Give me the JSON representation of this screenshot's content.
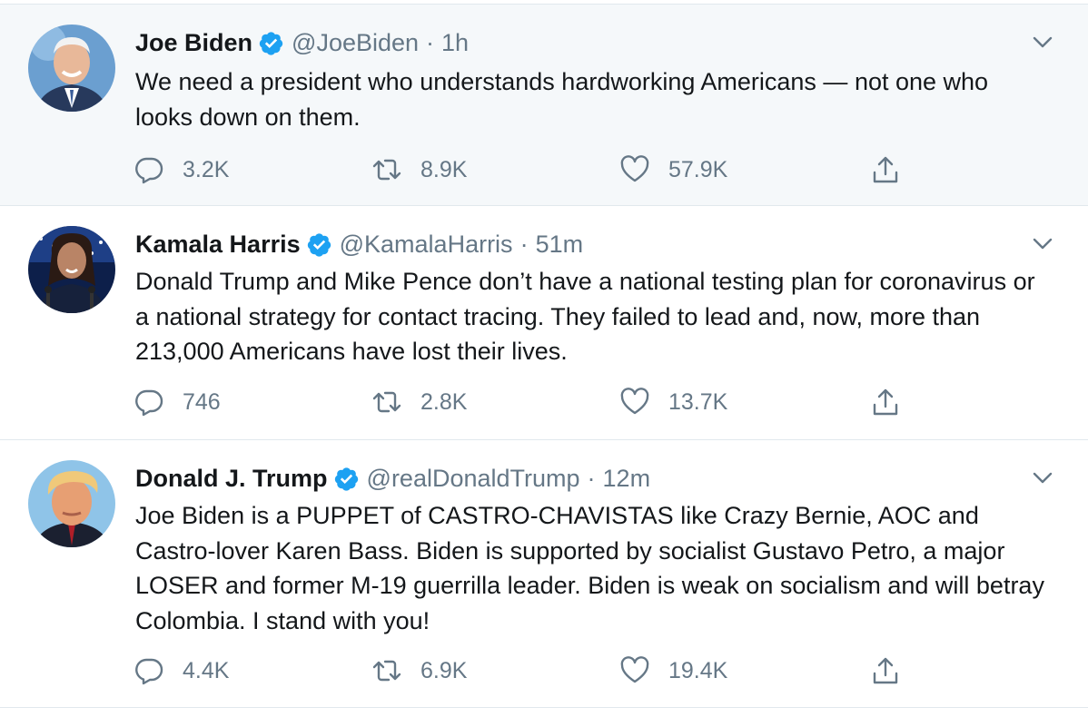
{
  "tweets": [
    {
      "name": "Joe Biden",
      "handle": "@JoeBiden",
      "separator": "·",
      "time": "1h",
      "text": "We need a president who understands hardworking Americans — not one who looks down on them.",
      "replies": "3.2K",
      "retweets": "8.9K",
      "likes": "57.9K"
    },
    {
      "name": "Kamala Harris",
      "handle": "@KamalaHarris",
      "separator": "·",
      "time": "51m",
      "text": "Donald Trump and Mike Pence don’t have a national testing plan for coronavirus or a national strategy for contact tracing. They failed to lead and, now, more than 213,000 Americans have lost their lives.",
      "replies": "746",
      "retweets": "2.8K",
      "likes": "13.7K"
    },
    {
      "name": "Donald J. Trump",
      "handle": "@realDonaldTrump",
      "separator": "·",
      "time": "12m",
      "text": "Joe Biden is a PUPPET of CASTRO-CHAVISTAS like Crazy Bernie, AOC and Castro-lover Karen Bass. Biden is supported by socialist Gustavo Petro, a major LOSER and former M-19 guerrilla leader. Biden is weak on socialism and will betray Colombia. I stand with you!",
      "replies": "4.4K",
      "retweets": "6.9K",
      "likes": "19.4K"
    }
  ],
  "colors": {
    "verified": "#1da1f2",
    "muted": "#657786",
    "text": "#14171a",
    "hover_bg": "#f5f8fa",
    "border": "#e1e8ed"
  },
  "icons": {
    "reply": "reply-icon",
    "retweet": "retweet-icon",
    "like": "heart-icon",
    "share": "share-icon",
    "menu": "chevron-down-icon",
    "verified": "verified-badge-icon"
  }
}
